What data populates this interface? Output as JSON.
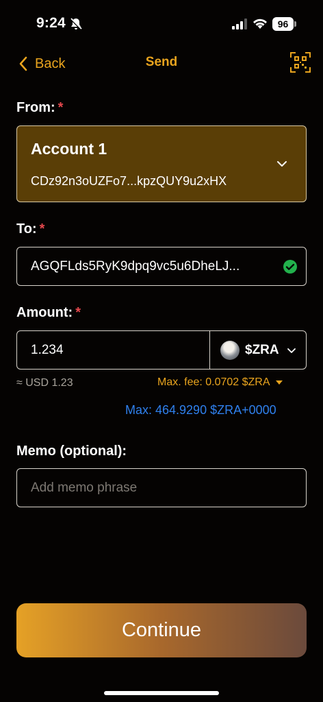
{
  "status_bar": {
    "time": "9:24",
    "battery": "96"
  },
  "header": {
    "back_label": "Back",
    "title": "Send"
  },
  "from": {
    "label": "From:",
    "required_mark": "*",
    "account_name": "Account 1",
    "account_address": "CDz92n3oUZFo7...kpzQUY9u2xHX"
  },
  "to": {
    "label": "To:",
    "required_mark": "*",
    "address": "AGQFLds5RyK9dpq9vc5u6DheLJ..."
  },
  "amount": {
    "label": "Amount:",
    "required_mark": "*",
    "value": "1.234",
    "token": "$ZRA",
    "usd_value": "≈ USD 1.23",
    "max_fee": "Max. fee: 0.0702 $ZRA",
    "max": "Max: 464.9290 $ZRA+0000"
  },
  "memo": {
    "label": "Memo (optional):",
    "placeholder": "Add memo phrase"
  },
  "continue_label": "Continue",
  "colors": {
    "accent": "#e9a41e",
    "link": "#2f80ed",
    "required": "#e5484d",
    "success": "#22b14c",
    "from_box": "#5a3e06"
  },
  "icons": [
    "bell-slash-icon",
    "signal-icon",
    "wifi-icon",
    "battery-icon",
    "chevron-left-icon",
    "qr-scan-icon",
    "chevron-down-icon",
    "check-circle-icon",
    "token-logo-icon"
  ]
}
